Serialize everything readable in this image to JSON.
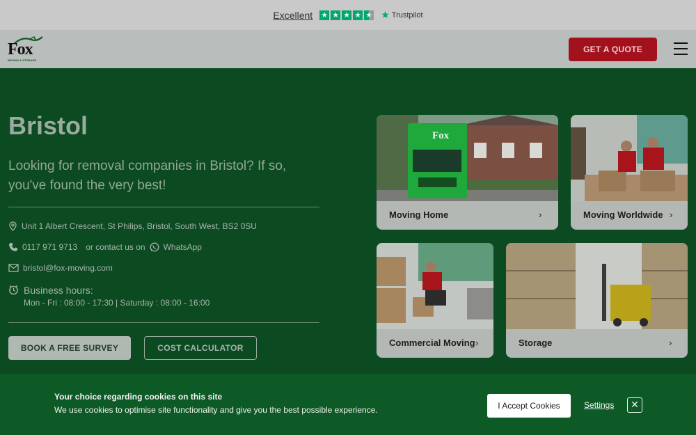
{
  "trustbar": {
    "rating_text": "Excellent",
    "brand": "Trustpilot",
    "stars": 4.5
  },
  "header": {
    "logo_text": "Fox",
    "logo_tagline": "MOVING & STORAGE",
    "quote_button": "GET A QUOTE",
    "menu_icon": "hamburger-menu-icon"
  },
  "hero": {
    "title": "Bristol",
    "subtitle": "Looking for removal companies in Bristol? If so, you've found the very best!",
    "address": "Unit 1 Albert Crescent, St Philips, Bristol, South West, BS2 0SU",
    "phone": "0117 971 9713",
    "contact_or": "or contact us on",
    "whatsapp": "WhatsApp",
    "email": "bristol@fox-moving.com",
    "hours_title": "Business hours:",
    "hours_text": "Mon - Fri : 08:00 - 17:30 | Saturday : 08:00 - 16:00",
    "survey_button": "BOOK A FREE SURVEY",
    "calculator_button": "COST CALCULATOR"
  },
  "services": [
    {
      "label": "Moving Home"
    },
    {
      "label": "Moving Worldwide"
    },
    {
      "label": "Commercial Moving"
    },
    {
      "label": "Storage"
    }
  ],
  "cookie": {
    "title": "Your choice regarding cookies on this site",
    "text": "We use cookies to optimise site functionality and give you the best possible experience.",
    "accept": "I Accept Cookies",
    "settings": "Settings",
    "close_icon": "close-icon"
  },
  "colors": {
    "brand_green": "#0c4a22",
    "cookie_green": "#0e5a26",
    "quote_red": "#a3111c",
    "trustpilot_green": "#00a86b"
  }
}
